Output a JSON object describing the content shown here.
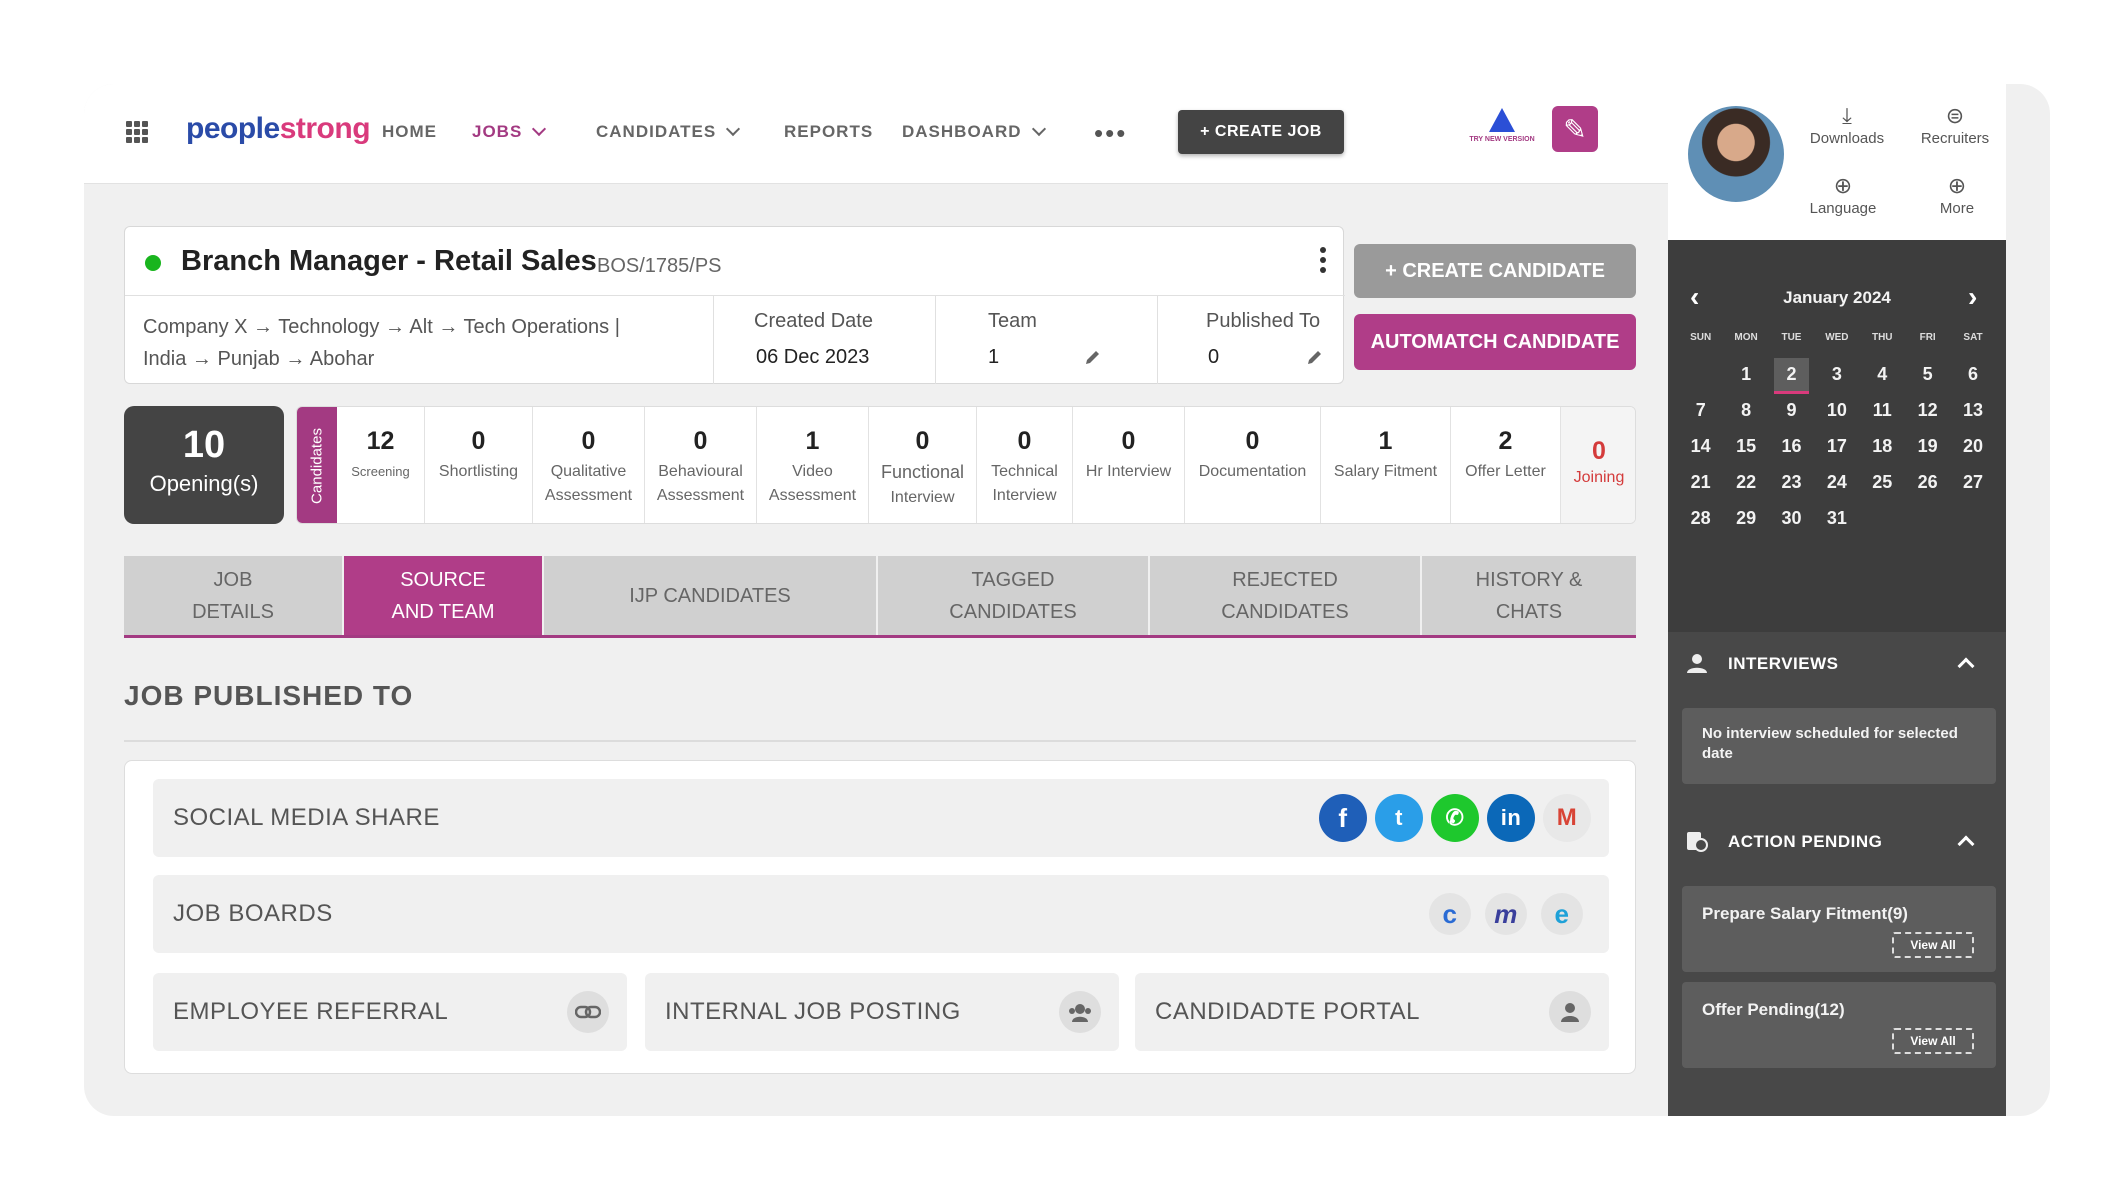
{
  "nav": {
    "logo_a": "people",
    "logo_b": "strong",
    "home": "HOME",
    "jobs": "JOBS",
    "candidates": "CANDIDATES",
    "reports": "REPORTS",
    "dashboard": "DASHBOARD",
    "more_dots": "•••",
    "create_job": "+ CREATE JOB",
    "try_new": "TRY NEW VERSION",
    "accent": "#a33a82"
  },
  "user_menu": {
    "downloads": "Downloads",
    "recruiters": "Recruiters",
    "language": "Language",
    "more": "More"
  },
  "calendar": {
    "month": "January 2024",
    "weekdays": [
      "SUN",
      "MON",
      "TUE",
      "WED",
      "THU",
      "FRI",
      "SAT"
    ],
    "selected_day": "2",
    "weeks": [
      [
        "",
        "1",
        "2",
        "3",
        "4",
        "5",
        "6"
      ],
      [
        "7",
        "8",
        "9",
        "10",
        "11",
        "12",
        "13"
      ],
      [
        "14",
        "15",
        "16",
        "17",
        "18",
        "19",
        "20"
      ],
      [
        "21",
        "22",
        "23",
        "24",
        "25",
        "26",
        "27"
      ],
      [
        "28",
        "29",
        "30",
        "31",
        "",
        "",
        ""
      ]
    ]
  },
  "interviews": {
    "title": "INTERVIEWS",
    "empty_message": "No interview scheduled for selected date"
  },
  "action_pending": {
    "title": "ACTION PENDING",
    "items": [
      {
        "label": "Prepare Salary Fitment(9)",
        "link": "View All"
      },
      {
        "label": "Offer Pending(12)",
        "link": "View All"
      }
    ]
  },
  "job": {
    "title": "Branch Manager - Retail Sales",
    "code": "BOS/1785/PS",
    "path_line1": "Company X → Technology → Alt → Tech Operations |",
    "path_line2": "India → Punjab → Abohar",
    "created_label": "Created Date",
    "created_value": "06 Dec 2023",
    "team_label": "Team",
    "team_value": "1",
    "published_label": "Published To",
    "published_value": "0",
    "status_color": "#19b51e"
  },
  "actions": {
    "create_candidate": "+ CREATE CANDIDATE",
    "automatch": "AUTOMATCH CANDIDATE"
  },
  "openings": {
    "count": "10",
    "label": "Opening(s)"
  },
  "pipeline": {
    "side_label": "Candidates",
    "stages": [
      {
        "count": "12",
        "label": "Screening"
      },
      {
        "count": "0",
        "label": "Shortlisting"
      },
      {
        "count": "0",
        "label1": "Qualitative",
        "label2": "Assessment"
      },
      {
        "count": "0",
        "label1": "Behavioural",
        "label2": "Assessment"
      },
      {
        "count": "1",
        "label1": "Video",
        "label2": "Assessment"
      },
      {
        "count": "0",
        "label1": "Functional",
        "label2": "Interview"
      },
      {
        "count": "0",
        "label1": "Technical",
        "label2": "Interview"
      },
      {
        "count": "0",
        "label": "Hr Interview"
      },
      {
        "count": "0",
        "label": "Documentation"
      },
      {
        "count": "1",
        "label": "Salary Fitment"
      },
      {
        "count": "2",
        "label": "Offer Letter"
      },
      {
        "count": "0",
        "label": "Joining"
      }
    ]
  },
  "tabs": [
    {
      "line1": "JOB",
      "line2": "DETAILS"
    },
    {
      "line1": "SOURCE",
      "line2": "AND TEAM"
    },
    {
      "line1": "IJP CANDIDATES",
      "line2": ""
    },
    {
      "line1": "TAGGED",
      "line2": "CANDIDATES"
    },
    {
      "line1": "REJECTED",
      "line2": "CANDIDATES"
    },
    {
      "line1": "HISTORY &",
      "line2": "CHATS"
    }
  ],
  "published": {
    "section_title": "JOB PUBLISHED TO",
    "social_media": "SOCIAL MEDIA SHARE",
    "job_boards": "JOB BOARDS",
    "employee_referral": "EMPLOYEE REFERRAL",
    "internal_job_posting": "INTERNAL JOB POSTING",
    "candidate_portal": "CANDIDADTE PORTAL",
    "social_icons": [
      "facebook-icon",
      "twitter-icon",
      "whatsapp-icon",
      "linkedin-icon",
      "gmail-icon"
    ],
    "social_colors": {
      "facebook": "#1f5fb8",
      "twitter": "#2a9ee8",
      "whatsapp": "#1ec82d",
      "linkedin": "#0b68b8"
    },
    "board_icons": [
      "board-c-icon",
      "board-m-icon",
      "board-e-icon"
    ]
  }
}
